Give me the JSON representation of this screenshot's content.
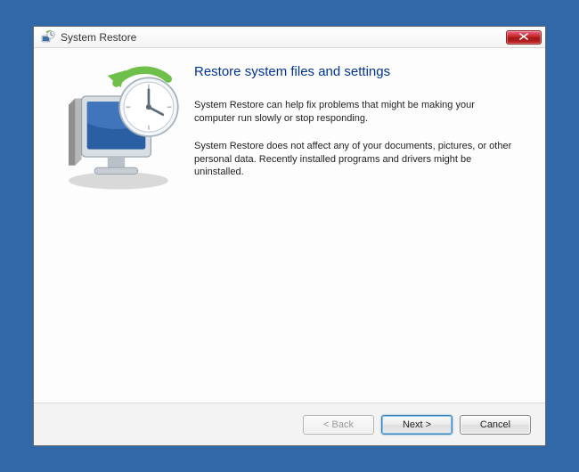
{
  "window": {
    "title": "System Restore"
  },
  "content": {
    "heading": "Restore system files and settings",
    "paragraph1": "System Restore can help fix problems that might be making your computer run slowly or stop responding.",
    "paragraph2": "System Restore does not affect any of your documents, pictures, or other personal data. Recently installed programs and drivers might be uninstalled."
  },
  "buttons": {
    "back": "< Back",
    "next": "Next >",
    "cancel": "Cancel"
  }
}
